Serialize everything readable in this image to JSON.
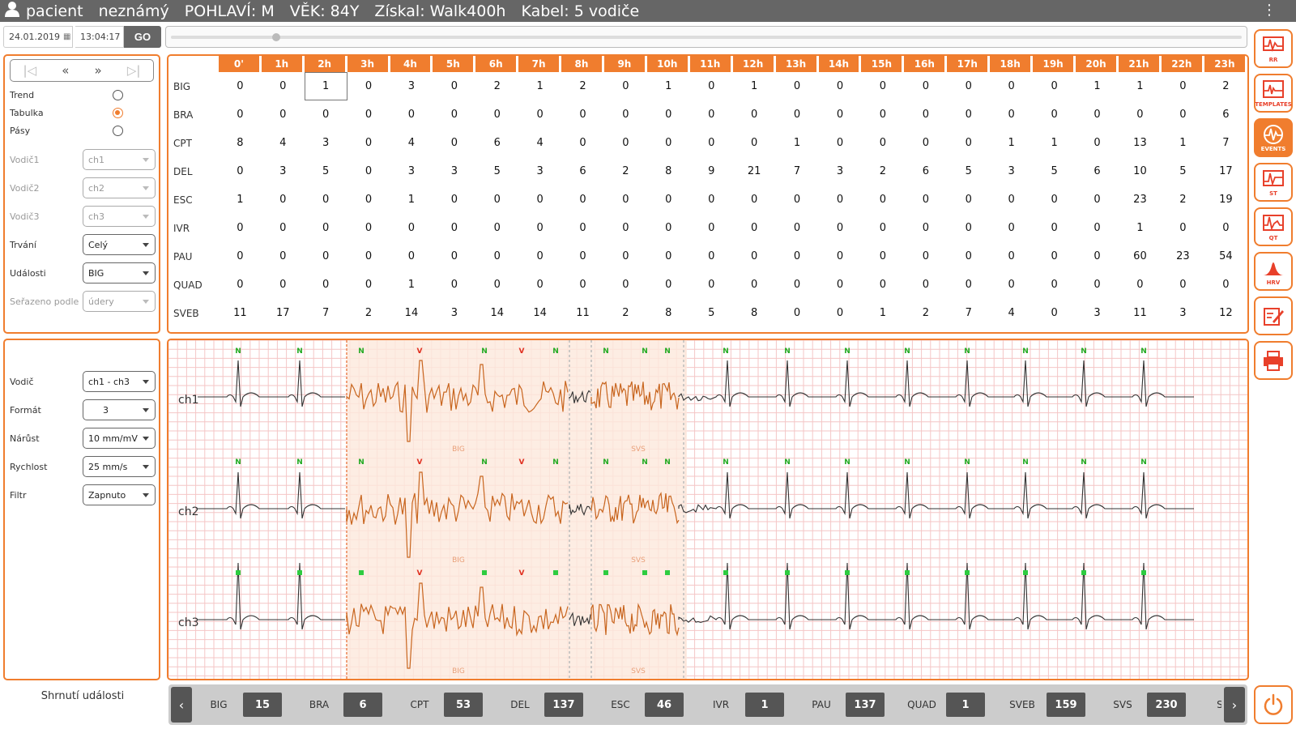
{
  "header": {
    "patient_label": "pacient",
    "patient_name": "neznámý",
    "sex": "POHLAVÍ: M",
    "age": "VĚK: 84Y",
    "recorder": "Získal: Walk400h",
    "cable": "Kabel: 5 vodiče"
  },
  "datebar": {
    "date": "24.01.2019",
    "time": "13:04:17",
    "go_label": "GO"
  },
  "view_mode": {
    "options": [
      {
        "label": "Trend",
        "selected": false
      },
      {
        "label": "Tabulka",
        "selected": true
      },
      {
        "label": "Pásy",
        "selected": false
      }
    ]
  },
  "filters": {
    "lead1": {
      "label": "Vodič1",
      "value": "ch1"
    },
    "lead2": {
      "label": "Vodič2",
      "value": "ch2"
    },
    "lead3": {
      "label": "Vodič3",
      "value": "ch3"
    },
    "duration": {
      "label": "Trvání",
      "value": "Celý"
    },
    "events": {
      "label": "Události",
      "value": "BIG"
    },
    "sorted_by": {
      "label": "Seřazeno podle",
      "value": "údery"
    }
  },
  "table": {
    "hours": [
      "0'",
      "1h",
      "2h",
      "3h",
      "4h",
      "5h",
      "6h",
      "7h",
      "8h",
      "9h",
      "10h",
      "11h",
      "12h",
      "13h",
      "14h",
      "15h",
      "16h",
      "17h",
      "18h",
      "19h",
      "20h",
      "21h",
      "22h",
      "23h"
    ],
    "rows": [
      {
        "label": "BIG",
        "values": [
          0,
          0,
          1,
          0,
          3,
          0,
          2,
          1,
          2,
          0,
          1,
          0,
          1,
          0,
          0,
          0,
          0,
          0,
          0,
          0,
          1,
          1,
          0,
          2
        ]
      },
      {
        "label": "BRA",
        "values": [
          0,
          0,
          0,
          0,
          0,
          0,
          0,
          0,
          0,
          0,
          0,
          0,
          0,
          0,
          0,
          0,
          0,
          0,
          0,
          0,
          0,
          0,
          0,
          6
        ]
      },
      {
        "label": "CPT",
        "values": [
          8,
          4,
          3,
          0,
          4,
          0,
          6,
          4,
          0,
          0,
          0,
          0,
          0,
          1,
          0,
          0,
          0,
          0,
          1,
          1,
          0,
          13,
          1,
          7
        ]
      },
      {
        "label": "DEL",
        "values": [
          0,
          3,
          5,
          0,
          3,
          3,
          5,
          3,
          6,
          2,
          8,
          9,
          21,
          7,
          3,
          2,
          6,
          5,
          3,
          5,
          6,
          10,
          5,
          17
        ]
      },
      {
        "label": "ESC",
        "values": [
          1,
          0,
          0,
          0,
          1,
          0,
          0,
          0,
          0,
          0,
          0,
          0,
          0,
          0,
          0,
          0,
          0,
          0,
          0,
          0,
          0,
          23,
          2,
          19
        ]
      },
      {
        "label": "IVR",
        "values": [
          0,
          0,
          0,
          0,
          0,
          0,
          0,
          0,
          0,
          0,
          0,
          0,
          0,
          0,
          0,
          0,
          0,
          0,
          0,
          0,
          0,
          1,
          0,
          0
        ]
      },
      {
        "label": "PAU",
        "values": [
          0,
          0,
          0,
          0,
          0,
          0,
          0,
          0,
          0,
          0,
          0,
          0,
          0,
          0,
          0,
          0,
          0,
          0,
          0,
          0,
          0,
          60,
          23,
          54
        ]
      },
      {
        "label": "QUAD",
        "values": [
          0,
          0,
          0,
          0,
          1,
          0,
          0,
          0,
          0,
          0,
          0,
          0,
          0,
          0,
          0,
          0,
          0,
          0,
          0,
          0,
          0,
          0,
          0,
          0
        ]
      },
      {
        "label": "SVEB",
        "values": [
          11,
          17,
          7,
          2,
          14,
          3,
          14,
          14,
          11,
          2,
          8,
          5,
          8,
          0,
          0,
          1,
          2,
          7,
          4,
          0,
          3,
          11,
          3,
          12
        ]
      }
    ],
    "highlight": {
      "row": 0,
      "col": 2
    }
  },
  "display": {
    "lead": {
      "label": "Vodič",
      "value": "ch1 - ch3"
    },
    "format": {
      "label": "Formát",
      "value": "3"
    },
    "gain": {
      "label": "Nárůst",
      "value": "10 mm/mV"
    },
    "speed": {
      "label": "Rychlost",
      "value": "25 mm/s"
    },
    "filter": {
      "label": "Filtr",
      "value": "Zapnuto"
    }
  },
  "ecg": {
    "channels": [
      "ch1",
      "ch2",
      "ch3"
    ],
    "event_labels": [
      "BIG",
      "SVS"
    ],
    "beat_marks": [
      "N",
      "N",
      "N",
      "V",
      "N",
      "V",
      "N",
      "N",
      "N",
      "N",
      "N",
      "N",
      "N",
      "N",
      "N",
      "N",
      "N",
      "N",
      "N"
    ],
    "trace_color": "#333333",
    "event_color": "#c8651e",
    "grid_color": "#f4c6c6"
  },
  "summary": {
    "title": "Shrnutí události",
    "items": [
      {
        "label": "BIG",
        "value": "15"
      },
      {
        "label": "BRA",
        "value": "6"
      },
      {
        "label": "CPT",
        "value": "53"
      },
      {
        "label": "DEL",
        "value": "137"
      },
      {
        "label": "ESC",
        "value": "46"
      },
      {
        "label": "IVR",
        "value": "1"
      },
      {
        "label": "PAU",
        "value": "137"
      },
      {
        "label": "QUAD",
        "value": "1"
      },
      {
        "label": "SVEB",
        "value": "159"
      },
      {
        "label": "SVS",
        "value": "230"
      },
      {
        "label": "SV",
        "value": ""
      }
    ]
  },
  "tools": [
    {
      "label": "RR",
      "icon": "rr-chart-icon"
    },
    {
      "label": "TEMPLATES",
      "icon": "templates-icon"
    },
    {
      "label": "EVENTS",
      "icon": "events-icon",
      "active": true
    },
    {
      "label": "ST",
      "icon": "st-segment-icon"
    },
    {
      "label": "QT",
      "icon": "qt-interval-icon"
    },
    {
      "label": "HRV",
      "icon": "hrv-icon"
    },
    {
      "label": "",
      "icon": "edit-report-icon"
    },
    {
      "label": "",
      "icon": "print-icon"
    }
  ],
  "accent": "#f07d2e"
}
